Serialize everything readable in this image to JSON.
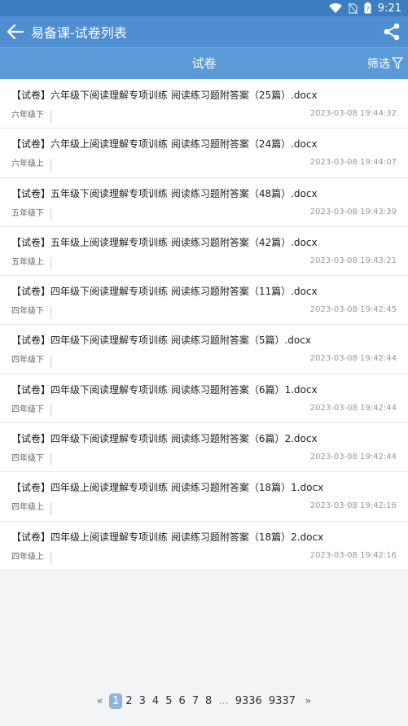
{
  "status": {
    "time": "9:21"
  },
  "appbar": {
    "title": "易备课-试卷列表"
  },
  "tabbar": {
    "title": "试卷",
    "filter_label": "筛选"
  },
  "items": [
    {
      "name": "【试卷】六年级下阅读理解专项训练 阅读练习题附答案（25篇）.docx",
      "tag": "六年级下",
      "time": "2023-03-08 19:44:32"
    },
    {
      "name": "【试卷】六年级上阅读理解专项训练 阅读练习题附答案（24篇）.docx",
      "tag": "六年级上",
      "time": "2023-03-08 19:44:07"
    },
    {
      "name": "【试卷】五年级下阅读理解专项训练 阅读练习题附答案（48篇）.docx",
      "tag": "五年级下",
      "time": "2023-03-08 19:43:39"
    },
    {
      "name": "【试卷】五年级上阅读理解专项训练 阅读练习题附答案（42篇）.docx",
      "tag": "五年级上",
      "time": "2023-03-08 19:43:21"
    },
    {
      "name": "【试卷】四年级下阅读理解专项训练 阅读练习题附答案（11篇）.docx",
      "tag": "四年级下",
      "time": "2023-03-08 19:42:45"
    },
    {
      "name": "【试卷】四年级下阅读理解专项训练 阅读练习题附答案（5篇）.docx",
      "tag": "四年级下",
      "time": "2023-03-08 19:42:44"
    },
    {
      "name": "【试卷】四年级下阅读理解专项训练 阅读练习题附答案（6篇）1.docx",
      "tag": "四年级下",
      "time": "2023-03-08 19:42:44"
    },
    {
      "name": "【试卷】四年级下阅读理解专项训练 阅读练习题附答案（6篇）2.docx",
      "tag": "四年级下",
      "time": "2023-03-08 19:42:44"
    },
    {
      "name": "【试卷】四年级上阅读理解专项训练 阅读练习题附答案（18篇）1.docx",
      "tag": "四年级上",
      "time": "2023-03-08 19:42:16"
    },
    {
      "name": "【试卷】四年级上阅读理解专项训练 阅读练习题附答案（18篇）2.docx",
      "tag": "四年级上",
      "time": "2023-03-08 19:42:16"
    }
  ],
  "pager": {
    "prev": "«",
    "pages": [
      "1",
      "2",
      "3",
      "4",
      "5",
      "6",
      "7",
      "8"
    ],
    "current": "1",
    "dots": "...",
    "last_pages": [
      "9336",
      "9337"
    ],
    "next": "»"
  },
  "colors": {
    "statusbar": "#3d7ec0",
    "appbar": "#4f8ed0",
    "tabbar": "#5b9ad7",
    "current_page": "#8fb5dd"
  },
  "icons": [
    "wifi-icon",
    "no-sim-icon",
    "battery-icon",
    "back-arrow-icon",
    "share-icon",
    "filter-icon"
  ]
}
